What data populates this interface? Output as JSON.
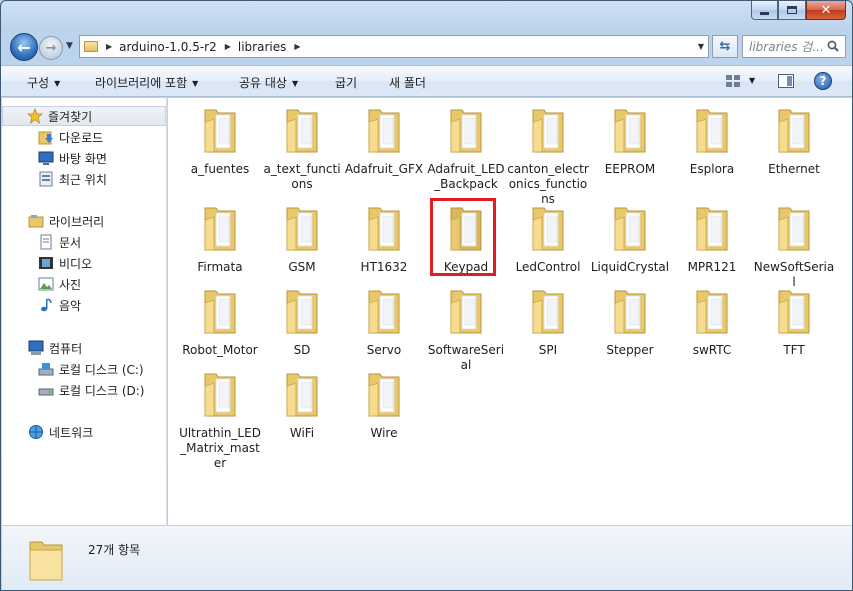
{
  "window": {
    "caption_buttons": {
      "minimize": "–",
      "maximize": "□",
      "close": "✕"
    }
  },
  "navbar": {
    "back_icon": "←",
    "forward_icon": "→",
    "breadcrumbs": [
      "arduino-1.0.5-r2",
      "libraries"
    ],
    "refresh_icon": "⇆",
    "search_placeholder": "libraries 검..."
  },
  "commandbar": {
    "organize": "구성",
    "include_in_library": "라이브러리에 포함",
    "share_with": "공유 대상",
    "burn": "굽기",
    "new_folder": "새 폴더",
    "help": "?"
  },
  "sidebar": {
    "favorites": {
      "label": "즐겨찾기",
      "items": [
        "다운로드",
        "바탕 화면",
        "최근 위치"
      ]
    },
    "libraries": {
      "label": "라이브러리",
      "items": [
        "문서",
        "비디오",
        "사진",
        "음악"
      ]
    },
    "computer": {
      "label": "컴퓨터",
      "items": [
        "로컬 디스크 (C:)",
        "로컬 디스크 (D:)"
      ]
    },
    "network": {
      "label": "네트워크"
    }
  },
  "folders": [
    "a_fuentes",
    "a_text_functions",
    "Adafruit_GFX",
    "Adafruit_LED_Backpack",
    "canton_electronics_functions",
    "EEPROM",
    "Esplora",
    "Ethernet",
    "Firmata",
    "GSM",
    "HT1632",
    "Keypad",
    "LedControl",
    "LiquidCrystal",
    "MPR121",
    "NewSoftSerial",
    "Robot_Motor",
    "SD",
    "Servo",
    "SoftwareSerial",
    "SPI",
    "Stepper",
    "swRTC",
    "TFT",
    "Ultrathin_LED_Matrix_master",
    "WiFi",
    "Wire"
  ],
  "highlighted_folder": "Keypad",
  "status": {
    "item_count": "27개 항목"
  },
  "colors": {
    "highlight": "#e01d25",
    "folder": "#f3d680"
  }
}
